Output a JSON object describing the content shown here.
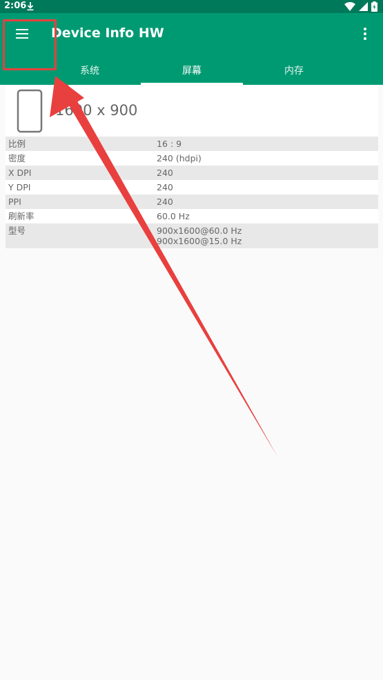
{
  "status": {
    "time": "2:06"
  },
  "app": {
    "title": "Device Info HW",
    "menu_icon": "hamburger-menu-icon",
    "more_icon": "more-vertical-icon"
  },
  "tabs": [
    {
      "label": "系统",
      "active": false
    },
    {
      "label": "屏幕",
      "active": true
    },
    {
      "label": "内存",
      "active": false
    }
  ],
  "display": {
    "resolution": "1600 x 900"
  },
  "info": {
    "rows": [
      {
        "label": "比例",
        "value": "16 : 9"
      },
      {
        "label": "密度",
        "value": "240 (hdpi)"
      },
      {
        "label": "X DPI",
        "value": "240"
      },
      {
        "label": "Y DPI",
        "value": "240"
      },
      {
        "label": "PPI",
        "value": "240"
      },
      {
        "label": "刷新率",
        "value": "60.0 Hz"
      },
      {
        "label": "型号",
        "values": [
          "900x1600@60.0 Hz",
          "900x1600@15.0 Hz"
        ]
      }
    ]
  },
  "colors": {
    "status_bar": "#00795a",
    "app_bar": "#009a72",
    "annotation": "#e8403e"
  }
}
